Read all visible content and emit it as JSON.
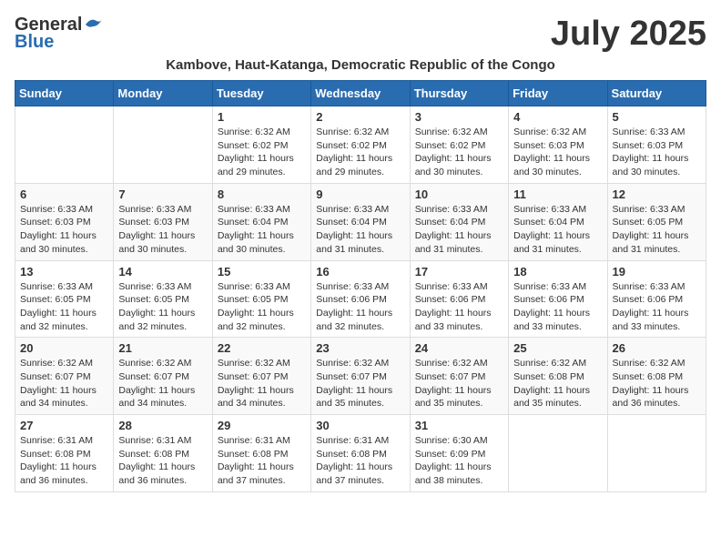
{
  "logo": {
    "general": "General",
    "blue": "Blue"
  },
  "title": "July 2025",
  "location": "Kambove, Haut-Katanga, Democratic Republic of the Congo",
  "weekdays": [
    "Sunday",
    "Monday",
    "Tuesday",
    "Wednesday",
    "Thursday",
    "Friday",
    "Saturday"
  ],
  "weeks": [
    [
      {
        "day": "",
        "info": ""
      },
      {
        "day": "",
        "info": ""
      },
      {
        "day": "1",
        "info": "Sunrise: 6:32 AM\nSunset: 6:02 PM\nDaylight: 11 hours and 29 minutes."
      },
      {
        "day": "2",
        "info": "Sunrise: 6:32 AM\nSunset: 6:02 PM\nDaylight: 11 hours and 29 minutes."
      },
      {
        "day": "3",
        "info": "Sunrise: 6:32 AM\nSunset: 6:02 PM\nDaylight: 11 hours and 30 minutes."
      },
      {
        "day": "4",
        "info": "Sunrise: 6:32 AM\nSunset: 6:03 PM\nDaylight: 11 hours and 30 minutes."
      },
      {
        "day": "5",
        "info": "Sunrise: 6:33 AM\nSunset: 6:03 PM\nDaylight: 11 hours and 30 minutes."
      }
    ],
    [
      {
        "day": "6",
        "info": "Sunrise: 6:33 AM\nSunset: 6:03 PM\nDaylight: 11 hours and 30 minutes."
      },
      {
        "day": "7",
        "info": "Sunrise: 6:33 AM\nSunset: 6:03 PM\nDaylight: 11 hours and 30 minutes."
      },
      {
        "day": "8",
        "info": "Sunrise: 6:33 AM\nSunset: 6:04 PM\nDaylight: 11 hours and 30 minutes."
      },
      {
        "day": "9",
        "info": "Sunrise: 6:33 AM\nSunset: 6:04 PM\nDaylight: 11 hours and 31 minutes."
      },
      {
        "day": "10",
        "info": "Sunrise: 6:33 AM\nSunset: 6:04 PM\nDaylight: 11 hours and 31 minutes."
      },
      {
        "day": "11",
        "info": "Sunrise: 6:33 AM\nSunset: 6:04 PM\nDaylight: 11 hours and 31 minutes."
      },
      {
        "day": "12",
        "info": "Sunrise: 6:33 AM\nSunset: 6:05 PM\nDaylight: 11 hours and 31 minutes."
      }
    ],
    [
      {
        "day": "13",
        "info": "Sunrise: 6:33 AM\nSunset: 6:05 PM\nDaylight: 11 hours and 32 minutes."
      },
      {
        "day": "14",
        "info": "Sunrise: 6:33 AM\nSunset: 6:05 PM\nDaylight: 11 hours and 32 minutes."
      },
      {
        "day": "15",
        "info": "Sunrise: 6:33 AM\nSunset: 6:05 PM\nDaylight: 11 hours and 32 minutes."
      },
      {
        "day": "16",
        "info": "Sunrise: 6:33 AM\nSunset: 6:06 PM\nDaylight: 11 hours and 32 minutes."
      },
      {
        "day": "17",
        "info": "Sunrise: 6:33 AM\nSunset: 6:06 PM\nDaylight: 11 hours and 33 minutes."
      },
      {
        "day": "18",
        "info": "Sunrise: 6:33 AM\nSunset: 6:06 PM\nDaylight: 11 hours and 33 minutes."
      },
      {
        "day": "19",
        "info": "Sunrise: 6:33 AM\nSunset: 6:06 PM\nDaylight: 11 hours and 33 minutes."
      }
    ],
    [
      {
        "day": "20",
        "info": "Sunrise: 6:32 AM\nSunset: 6:07 PM\nDaylight: 11 hours and 34 minutes."
      },
      {
        "day": "21",
        "info": "Sunrise: 6:32 AM\nSunset: 6:07 PM\nDaylight: 11 hours and 34 minutes."
      },
      {
        "day": "22",
        "info": "Sunrise: 6:32 AM\nSunset: 6:07 PM\nDaylight: 11 hours and 34 minutes."
      },
      {
        "day": "23",
        "info": "Sunrise: 6:32 AM\nSunset: 6:07 PM\nDaylight: 11 hours and 35 minutes."
      },
      {
        "day": "24",
        "info": "Sunrise: 6:32 AM\nSunset: 6:07 PM\nDaylight: 11 hours and 35 minutes."
      },
      {
        "day": "25",
        "info": "Sunrise: 6:32 AM\nSunset: 6:08 PM\nDaylight: 11 hours and 35 minutes."
      },
      {
        "day": "26",
        "info": "Sunrise: 6:32 AM\nSunset: 6:08 PM\nDaylight: 11 hours and 36 minutes."
      }
    ],
    [
      {
        "day": "27",
        "info": "Sunrise: 6:31 AM\nSunset: 6:08 PM\nDaylight: 11 hours and 36 minutes."
      },
      {
        "day": "28",
        "info": "Sunrise: 6:31 AM\nSunset: 6:08 PM\nDaylight: 11 hours and 36 minutes."
      },
      {
        "day": "29",
        "info": "Sunrise: 6:31 AM\nSunset: 6:08 PM\nDaylight: 11 hours and 37 minutes."
      },
      {
        "day": "30",
        "info": "Sunrise: 6:31 AM\nSunset: 6:08 PM\nDaylight: 11 hours and 37 minutes."
      },
      {
        "day": "31",
        "info": "Sunrise: 6:30 AM\nSunset: 6:09 PM\nDaylight: 11 hours and 38 minutes."
      },
      {
        "day": "",
        "info": ""
      },
      {
        "day": "",
        "info": ""
      }
    ]
  ]
}
